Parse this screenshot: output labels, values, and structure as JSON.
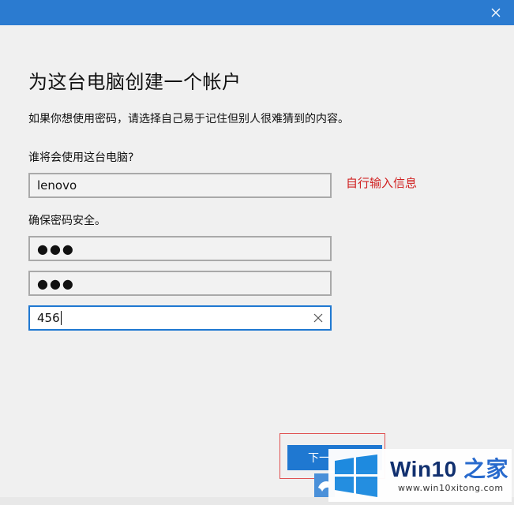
{
  "dialog": {
    "heading": "为这台电脑创建一个帐户",
    "subtext": "如果你想使用密码，请选择自己易于记住但别人很难猜到的内容。",
    "user_label": "谁将会使用这台电脑?",
    "username_value": "lenovo",
    "password_label": "确保密码安全。",
    "password_mask": "●●●",
    "password_confirm_mask": "●●●",
    "hint_value": "456",
    "next_label": "下一"
  },
  "annotation": {
    "text": "自行输入信息",
    "color": "#d02020"
  },
  "watermark": {
    "brand_latin": "Win10",
    "brand_zh": " 之家",
    "url": "www.win10xitong.com"
  },
  "colors": {
    "titlebar": "#2b7bd0",
    "accent": "#1f78d1"
  }
}
